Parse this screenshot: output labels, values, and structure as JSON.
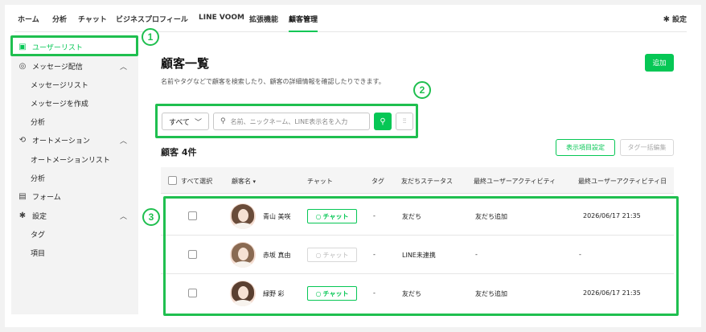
{
  "nav": {
    "items": [
      "ホーム",
      "分析",
      "チャット",
      "ビジネスプロフィール",
      "LINE VOOM",
      "拡張機能",
      "顧客管理"
    ],
    "active_index": 6,
    "settings_label": "設定",
    "settings_icon": "gear-icon"
  },
  "sidebar": {
    "user_list": "ユーザーリスト",
    "message": "メッセージ配信",
    "message_list": "メッセージリスト",
    "message_create": "メッセージを作成",
    "message_analysis": "分析",
    "automation": "オートメーション",
    "automation_list": "オートメーションリスト",
    "automation_analysis": "分析",
    "form": "フォーム",
    "settings": "設定",
    "tags": "タグ",
    "fields": "項目"
  },
  "badges": [
    "1",
    "2",
    "3"
  ],
  "main": {
    "title": "顧客一覧",
    "description": "名前やタグなどで顧客を検索したり、顧客の詳細情報を確認したりできます。",
    "add_button": "追加",
    "filter_select": "すべて",
    "search_placeholder": "名前、ニックネーム、LINE表示名を入力",
    "count_label": "顧客 4件",
    "display_settings_button": "表示項目設定",
    "bulk_tag_button": "タグ一括編集"
  },
  "table": {
    "headers": {
      "select_all": "すべて選択",
      "name": "顧客名",
      "chat": "チャット",
      "tag": "タグ",
      "friend_status": "友だちステータス",
      "last_activity": "最終ユーザーアクティビティ",
      "last_activity_date": "最終ユーザーアクティビティ日"
    },
    "rows": [
      {
        "name": "青山 美咲",
        "chat": "チャット",
        "chat_enabled": true,
        "tag": "-",
        "status": "友だち",
        "activity": "友だち追加",
        "date": "2026/06/17 21:35"
      },
      {
        "name": "赤坂 真由",
        "chat": "チャット",
        "chat_enabled": false,
        "tag": "-",
        "status": "LINE未連携",
        "activity": "-",
        "date": "-"
      },
      {
        "name": "緑野 彩",
        "chat": "チャット",
        "chat_enabled": true,
        "tag": "-",
        "status": "友だち",
        "activity": "友だち追加",
        "date": "2026/06/17 21:35"
      }
    ]
  },
  "colors": {
    "accent": "#06c755",
    "highlight": "#1fbf4f"
  }
}
